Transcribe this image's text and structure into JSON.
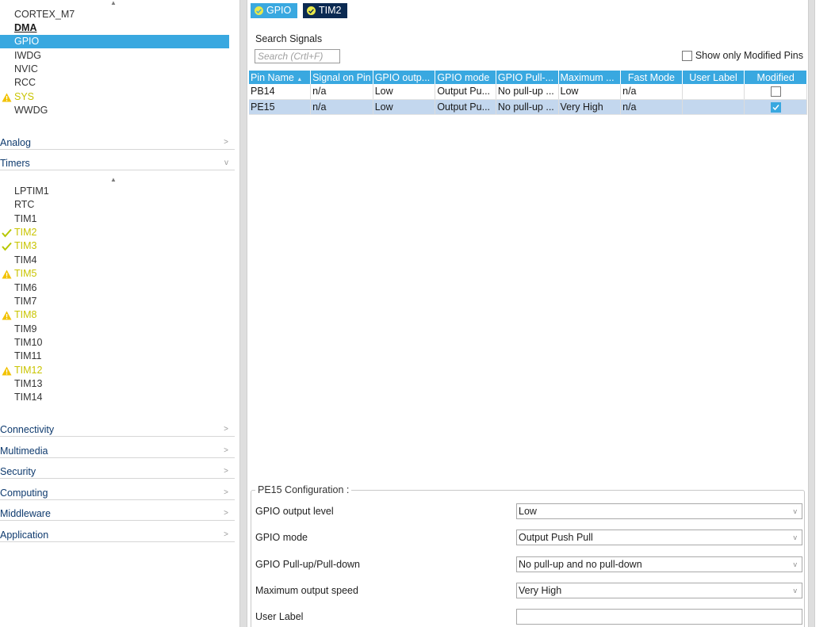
{
  "system_core_items": [
    {
      "label": "CORTEX_M7",
      "state": "normal"
    },
    {
      "label": "DMA",
      "state": "bold"
    },
    {
      "label": "GPIO",
      "state": "selected"
    },
    {
      "label": "IWDG",
      "state": "normal"
    },
    {
      "label": "NVIC",
      "state": "normal"
    },
    {
      "label": "RCC",
      "state": "normal"
    },
    {
      "label": "SYS",
      "state": "warning"
    },
    {
      "label": "WWDG",
      "state": "normal"
    }
  ],
  "categories": {
    "analog": "Analog",
    "timers": "Timers",
    "connectivity": "Connectivity",
    "multimedia": "Multimedia",
    "security": "Security",
    "computing": "Computing",
    "middleware": "Middleware",
    "application": "Application"
  },
  "timer_items": [
    {
      "label": "LPTIM1",
      "state": "normal"
    },
    {
      "label": "RTC",
      "state": "normal"
    },
    {
      "label": "TIM1",
      "state": "normal"
    },
    {
      "label": "TIM2",
      "state": "ok"
    },
    {
      "label": "TIM3",
      "state": "ok"
    },
    {
      "label": "TIM4",
      "state": "normal"
    },
    {
      "label": "TIM5",
      "state": "warning"
    },
    {
      "label": "TIM6",
      "state": "normal"
    },
    {
      "label": "TIM7",
      "state": "normal"
    },
    {
      "label": "TIM8",
      "state": "warning"
    },
    {
      "label": "TIM9",
      "state": "normal"
    },
    {
      "label": "TIM10",
      "state": "normal"
    },
    {
      "label": "TIM11",
      "state": "normal"
    },
    {
      "label": "TIM12",
      "state": "warning"
    },
    {
      "label": "TIM13",
      "state": "normal"
    },
    {
      "label": "TIM14",
      "state": "normal"
    }
  ],
  "tabs": [
    {
      "label": "GPIO",
      "active": false
    },
    {
      "label": "TIM2",
      "active": true
    }
  ],
  "search": {
    "label": "Search Signals",
    "placeholder": "Search (Crtl+F)",
    "show_modified_label": "Show only Modified Pins"
  },
  "table": {
    "headers": [
      "Pin Name",
      "Signal on Pin",
      "GPIO outp...",
      "GPIO mode",
      "GPIO Pull-...",
      "Maximum ...",
      "Fast Mode",
      "User Label",
      "Modified"
    ],
    "rows": [
      {
        "pin": "PB14",
        "signal": "n/a",
        "output": "Low",
        "mode": "Output Pu...",
        "pull": "No pull-up ...",
        "speed": "Low",
        "fast": "n/a",
        "label": "",
        "modified": false,
        "selected": false
      },
      {
        "pin": "PE15",
        "signal": "n/a",
        "output": "Low",
        "mode": "Output Pu...",
        "pull": "No pull-up ...",
        "speed": "Very High",
        "fast": "n/a",
        "label": "",
        "modified": true,
        "selected": true
      }
    ]
  },
  "config": {
    "title": "PE15 Configuration :",
    "fields": [
      {
        "label": "GPIO output level",
        "value": "Low",
        "type": "select"
      },
      {
        "label": "GPIO mode",
        "value": "Output Push Pull",
        "type": "select"
      },
      {
        "label": "GPIO Pull-up/Pull-down",
        "value": "No pull-up and no pull-down",
        "type": "select"
      },
      {
        "label": "Maximum output speed",
        "value": "Very High",
        "type": "select"
      },
      {
        "label": "User Label",
        "value": "",
        "type": "input"
      }
    ]
  },
  "colors": {
    "selection": "#39a8e0",
    "tab_active": "#0b2a52",
    "tab_inactive": "#39a8e0",
    "ok_warn_text": "#c9c400",
    "warning_icon": "#f2c200",
    "row_selected": "#c3d7ee"
  }
}
